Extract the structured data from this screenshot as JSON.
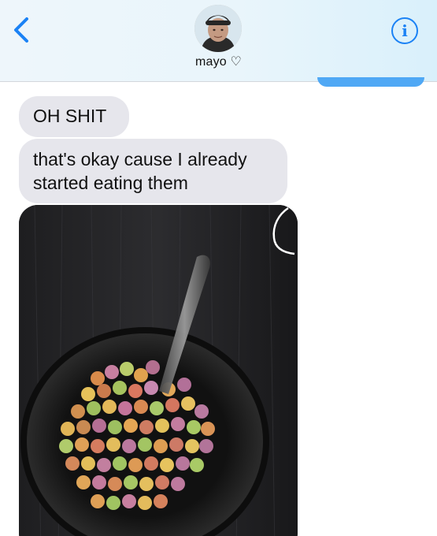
{
  "header": {
    "contact_name": "mayo ♡",
    "back_icon": "chevron-left-icon",
    "info_icon": "info-icon",
    "info_glyph": "i",
    "accent_color": "#1b82f5"
  },
  "messages": [
    {
      "direction": "incoming",
      "type": "text",
      "text": "OH SHIT"
    },
    {
      "direction": "incoming",
      "type": "text",
      "text": "that's okay cause I already started eating them"
    },
    {
      "direction": "incoming",
      "type": "image",
      "subject": "bowl of fruity ring cereal with spoon on dark wood table"
    }
  ],
  "colors": {
    "incoming_bubble": "#e6e6ec",
    "outgoing_bubble": "#4fa8f5"
  }
}
